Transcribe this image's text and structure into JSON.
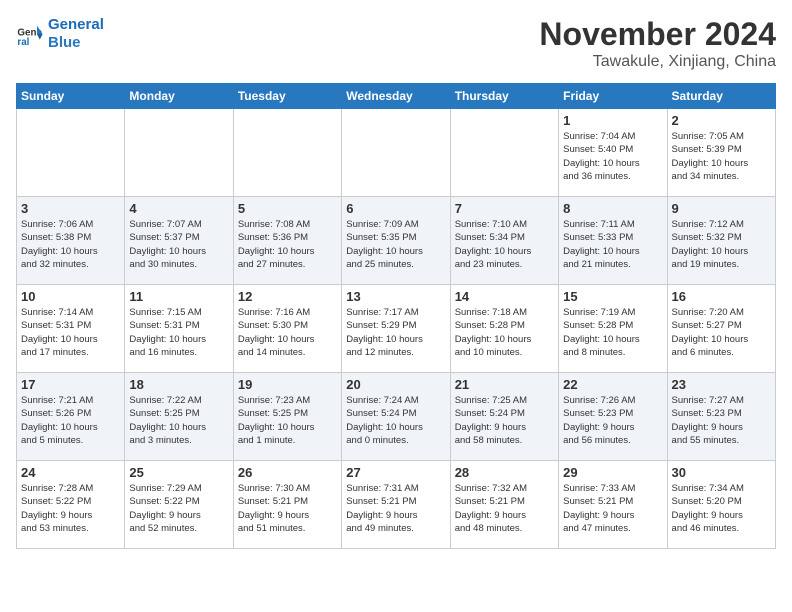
{
  "logo": {
    "line1": "General",
    "line2": "Blue"
  },
  "title": "November 2024",
  "location": "Tawakule, Xinjiang, China",
  "days_of_week": [
    "Sunday",
    "Monday",
    "Tuesday",
    "Wednesday",
    "Thursday",
    "Friday",
    "Saturday"
  ],
  "weeks": [
    [
      {
        "num": "",
        "info": ""
      },
      {
        "num": "",
        "info": ""
      },
      {
        "num": "",
        "info": ""
      },
      {
        "num": "",
        "info": ""
      },
      {
        "num": "",
        "info": ""
      },
      {
        "num": "1",
        "info": "Sunrise: 7:04 AM\nSunset: 5:40 PM\nDaylight: 10 hours\nand 36 minutes."
      },
      {
        "num": "2",
        "info": "Sunrise: 7:05 AM\nSunset: 5:39 PM\nDaylight: 10 hours\nand 34 minutes."
      }
    ],
    [
      {
        "num": "3",
        "info": "Sunrise: 7:06 AM\nSunset: 5:38 PM\nDaylight: 10 hours\nand 32 minutes."
      },
      {
        "num": "4",
        "info": "Sunrise: 7:07 AM\nSunset: 5:37 PM\nDaylight: 10 hours\nand 30 minutes."
      },
      {
        "num": "5",
        "info": "Sunrise: 7:08 AM\nSunset: 5:36 PM\nDaylight: 10 hours\nand 27 minutes."
      },
      {
        "num": "6",
        "info": "Sunrise: 7:09 AM\nSunset: 5:35 PM\nDaylight: 10 hours\nand 25 minutes."
      },
      {
        "num": "7",
        "info": "Sunrise: 7:10 AM\nSunset: 5:34 PM\nDaylight: 10 hours\nand 23 minutes."
      },
      {
        "num": "8",
        "info": "Sunrise: 7:11 AM\nSunset: 5:33 PM\nDaylight: 10 hours\nand 21 minutes."
      },
      {
        "num": "9",
        "info": "Sunrise: 7:12 AM\nSunset: 5:32 PM\nDaylight: 10 hours\nand 19 minutes."
      }
    ],
    [
      {
        "num": "10",
        "info": "Sunrise: 7:14 AM\nSunset: 5:31 PM\nDaylight: 10 hours\nand 17 minutes."
      },
      {
        "num": "11",
        "info": "Sunrise: 7:15 AM\nSunset: 5:31 PM\nDaylight: 10 hours\nand 16 minutes."
      },
      {
        "num": "12",
        "info": "Sunrise: 7:16 AM\nSunset: 5:30 PM\nDaylight: 10 hours\nand 14 minutes."
      },
      {
        "num": "13",
        "info": "Sunrise: 7:17 AM\nSunset: 5:29 PM\nDaylight: 10 hours\nand 12 minutes."
      },
      {
        "num": "14",
        "info": "Sunrise: 7:18 AM\nSunset: 5:28 PM\nDaylight: 10 hours\nand 10 minutes."
      },
      {
        "num": "15",
        "info": "Sunrise: 7:19 AM\nSunset: 5:28 PM\nDaylight: 10 hours\nand 8 minutes."
      },
      {
        "num": "16",
        "info": "Sunrise: 7:20 AM\nSunset: 5:27 PM\nDaylight: 10 hours\nand 6 minutes."
      }
    ],
    [
      {
        "num": "17",
        "info": "Sunrise: 7:21 AM\nSunset: 5:26 PM\nDaylight: 10 hours\nand 5 minutes."
      },
      {
        "num": "18",
        "info": "Sunrise: 7:22 AM\nSunset: 5:25 PM\nDaylight: 10 hours\nand 3 minutes."
      },
      {
        "num": "19",
        "info": "Sunrise: 7:23 AM\nSunset: 5:25 PM\nDaylight: 10 hours\nand 1 minute."
      },
      {
        "num": "20",
        "info": "Sunrise: 7:24 AM\nSunset: 5:24 PM\nDaylight: 10 hours\nand 0 minutes."
      },
      {
        "num": "21",
        "info": "Sunrise: 7:25 AM\nSunset: 5:24 PM\nDaylight: 9 hours\nand 58 minutes."
      },
      {
        "num": "22",
        "info": "Sunrise: 7:26 AM\nSunset: 5:23 PM\nDaylight: 9 hours\nand 56 minutes."
      },
      {
        "num": "23",
        "info": "Sunrise: 7:27 AM\nSunset: 5:23 PM\nDaylight: 9 hours\nand 55 minutes."
      }
    ],
    [
      {
        "num": "24",
        "info": "Sunrise: 7:28 AM\nSunset: 5:22 PM\nDaylight: 9 hours\nand 53 minutes."
      },
      {
        "num": "25",
        "info": "Sunrise: 7:29 AM\nSunset: 5:22 PM\nDaylight: 9 hours\nand 52 minutes."
      },
      {
        "num": "26",
        "info": "Sunrise: 7:30 AM\nSunset: 5:21 PM\nDaylight: 9 hours\nand 51 minutes."
      },
      {
        "num": "27",
        "info": "Sunrise: 7:31 AM\nSunset: 5:21 PM\nDaylight: 9 hours\nand 49 minutes."
      },
      {
        "num": "28",
        "info": "Sunrise: 7:32 AM\nSunset: 5:21 PM\nDaylight: 9 hours\nand 48 minutes."
      },
      {
        "num": "29",
        "info": "Sunrise: 7:33 AM\nSunset: 5:21 PM\nDaylight: 9 hours\nand 47 minutes."
      },
      {
        "num": "30",
        "info": "Sunrise: 7:34 AM\nSunset: 5:20 PM\nDaylight: 9 hours\nand 46 minutes."
      }
    ]
  ]
}
